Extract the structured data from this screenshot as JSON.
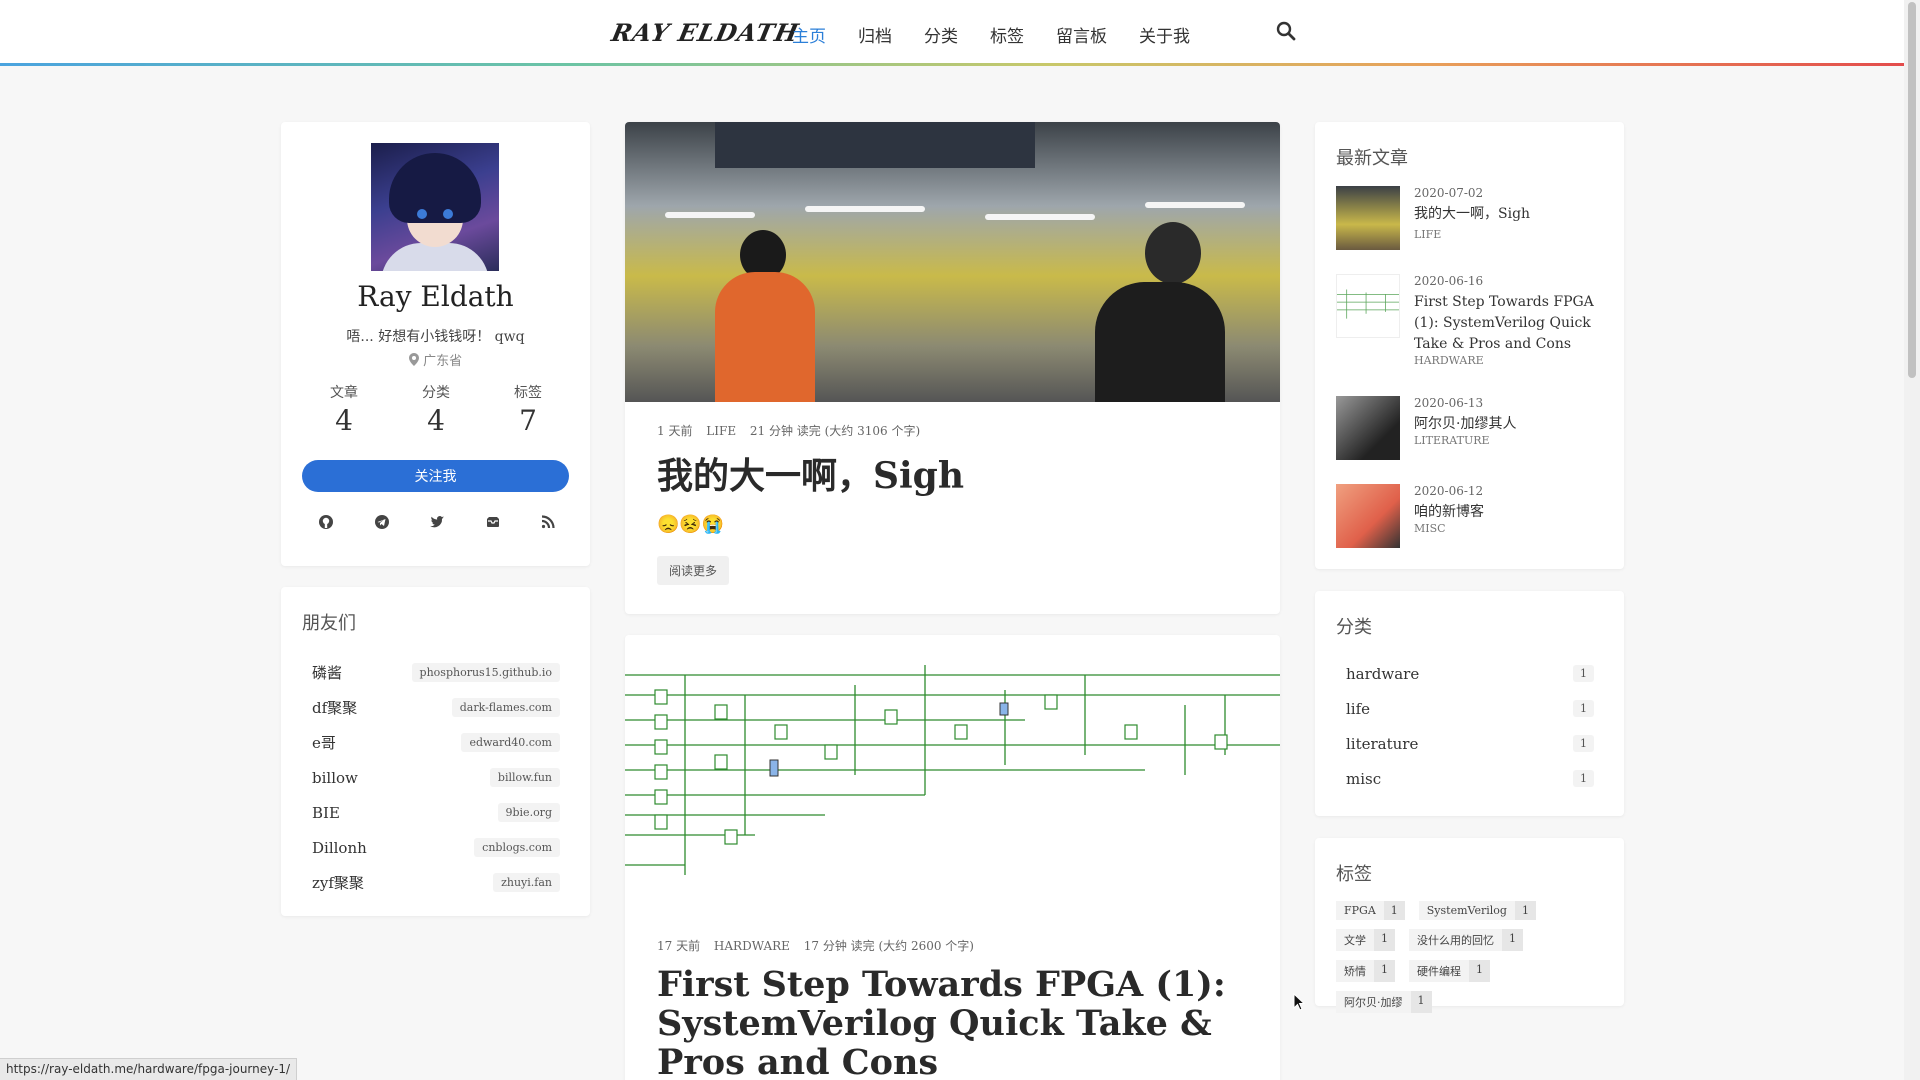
{
  "nav": {
    "logo": "RAY ELDATH",
    "items": [
      {
        "label": "主页",
        "active": true
      },
      {
        "label": "归档",
        "active": false
      },
      {
        "label": "分类",
        "active": false
      },
      {
        "label": "标签",
        "active": false
      },
      {
        "label": "留言板",
        "active": false
      },
      {
        "label": "关于我",
        "active": false
      }
    ],
    "search_icon": "search-icon"
  },
  "profile": {
    "name": "Ray Eldath",
    "bio": "唔... 好想有小钱钱呀！ qwq",
    "location": "广东省",
    "stats": [
      {
        "label": "文章",
        "value": "4"
      },
      {
        "label": "分类",
        "value": "4"
      },
      {
        "label": "标签",
        "value": "7"
      }
    ],
    "follow_label": "关注我",
    "social_icons": [
      "github-icon",
      "telegram-icon",
      "twitter-icon",
      "email-icon",
      "rss-icon"
    ]
  },
  "friends": {
    "title": "朋友们",
    "items": [
      {
        "name": "磷酱",
        "link": "phosphorus15.github.io"
      },
      {
        "name": "df聚聚",
        "link": "dark-flames.com"
      },
      {
        "name": "e哥",
        "link": "edward40.com"
      },
      {
        "name": "billow",
        "link": "billow.fun"
      },
      {
        "name": "BIE",
        "link": "9bie.org"
      },
      {
        "name": "Dillonh",
        "link": "cnblogs.com"
      },
      {
        "name": "zyf聚聚",
        "link": "zhuyi.fan"
      }
    ]
  },
  "posts": [
    {
      "time": "1 天前",
      "category": "LIFE",
      "read": "21 分钟 读完 (大约 3106 个字)",
      "title": "我的大一啊，Sigh",
      "excerpt": "😞😣😭",
      "read_more": "阅读更多"
    },
    {
      "time": "17 天前",
      "category": "HARDWARE",
      "read": "17 分钟 读完 (大约 2600 个字)",
      "title": "First Step Towards FPGA (1): SystemVerilog Quick Take & Pros and Cons"
    }
  ],
  "recent": {
    "title": "最新文章",
    "items": [
      {
        "date": "2020-07-02",
        "title": "我的大一啊，Sigh",
        "category": "LIFE"
      },
      {
        "date": "2020-06-16",
        "title": "First Step Towards FPGA (1): SystemVerilog Quick Take & Pros and Cons",
        "category": "HARDWARE"
      },
      {
        "date": "2020-06-13",
        "title": "阿尔贝·加缪其人",
        "category": "LITERATURE"
      },
      {
        "date": "2020-06-12",
        "title": "咱的新博客",
        "category": "MISC"
      }
    ]
  },
  "categories": {
    "title": "分类",
    "items": [
      {
        "name": "hardware",
        "count": "1"
      },
      {
        "name": "life",
        "count": "1"
      },
      {
        "name": "literature",
        "count": "1"
      },
      {
        "name": "misc",
        "count": "1"
      }
    ]
  },
  "tags": {
    "title": "标签",
    "items": [
      {
        "name": "FPGA",
        "count": "1"
      },
      {
        "name": "SystemVerilog",
        "count": "1"
      },
      {
        "name": "文学",
        "count": "1"
      },
      {
        "name": "没什么用的回忆",
        "count": "1"
      },
      {
        "name": "矫情",
        "count": "1"
      },
      {
        "name": "硬件编程",
        "count": "1"
      },
      {
        "name": "阿尔贝·加缪",
        "count": "1"
      }
    ]
  },
  "status_url": "https://ray-eldath.me/hardware/fpga-journey-1/",
  "colors": {
    "accent": "#2b7fd8",
    "button": "#2b6fd6"
  }
}
